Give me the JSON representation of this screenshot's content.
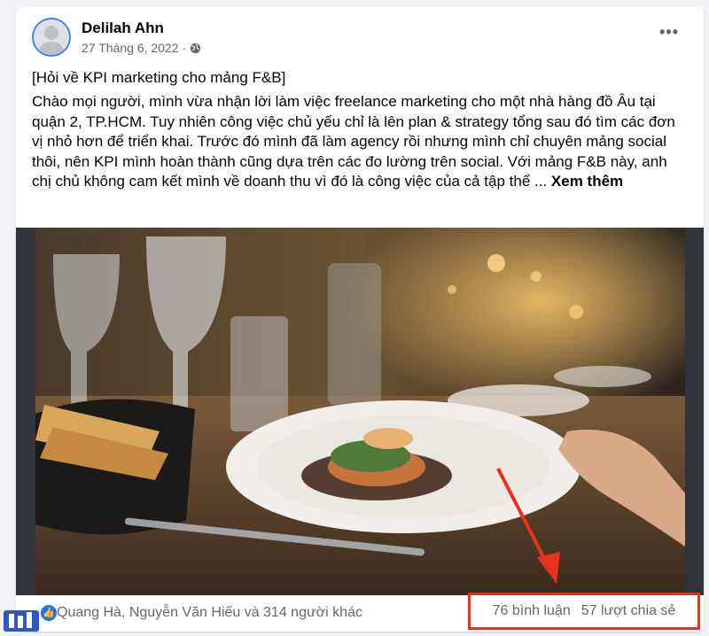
{
  "post": {
    "author": "Delilah Ahn",
    "date": "27 Tháng 6, 2022",
    "privacy_icon": "globe-icon",
    "more_label": "•••",
    "title": "[Hỏi về KPI marketing cho mảng F&B]",
    "body": "Chào mọi người, mình vừa nhận lời làm việc freelance marketing cho một nhà hàng đồ Âu tại quận 2, TP.HCM. Tuy nhiên công việc chủ yếu chỉ là lên plan & strategy tổng sau đó tìm các đơn vị nhỏ hơn để triển khai. Trước đó mình đã làm agency rồi nhưng mình chỉ chuyên mảng social thôi, nên KPI mình hoàn thành cũng dựa trên các đo lường trên social. Với mảng F&B này, anh chị chủ không cam kết mình về doanh thu vì đó là công việc của cả tập thể ...",
    "see_more": "Xem thêm",
    "photo_alt": "Bàn ăn nhà hàng với ly rượu, giỏ bánh mì và đĩa món ăn"
  },
  "footer": {
    "reactions": "Quang Hà, Nguyễn Văn Hiếu và 314 người khác",
    "comments": "76 bình luận",
    "shares": "57 lượt chia sẻ"
  },
  "colors": {
    "accent": "#1877f2",
    "highlight": "#e8321e"
  }
}
